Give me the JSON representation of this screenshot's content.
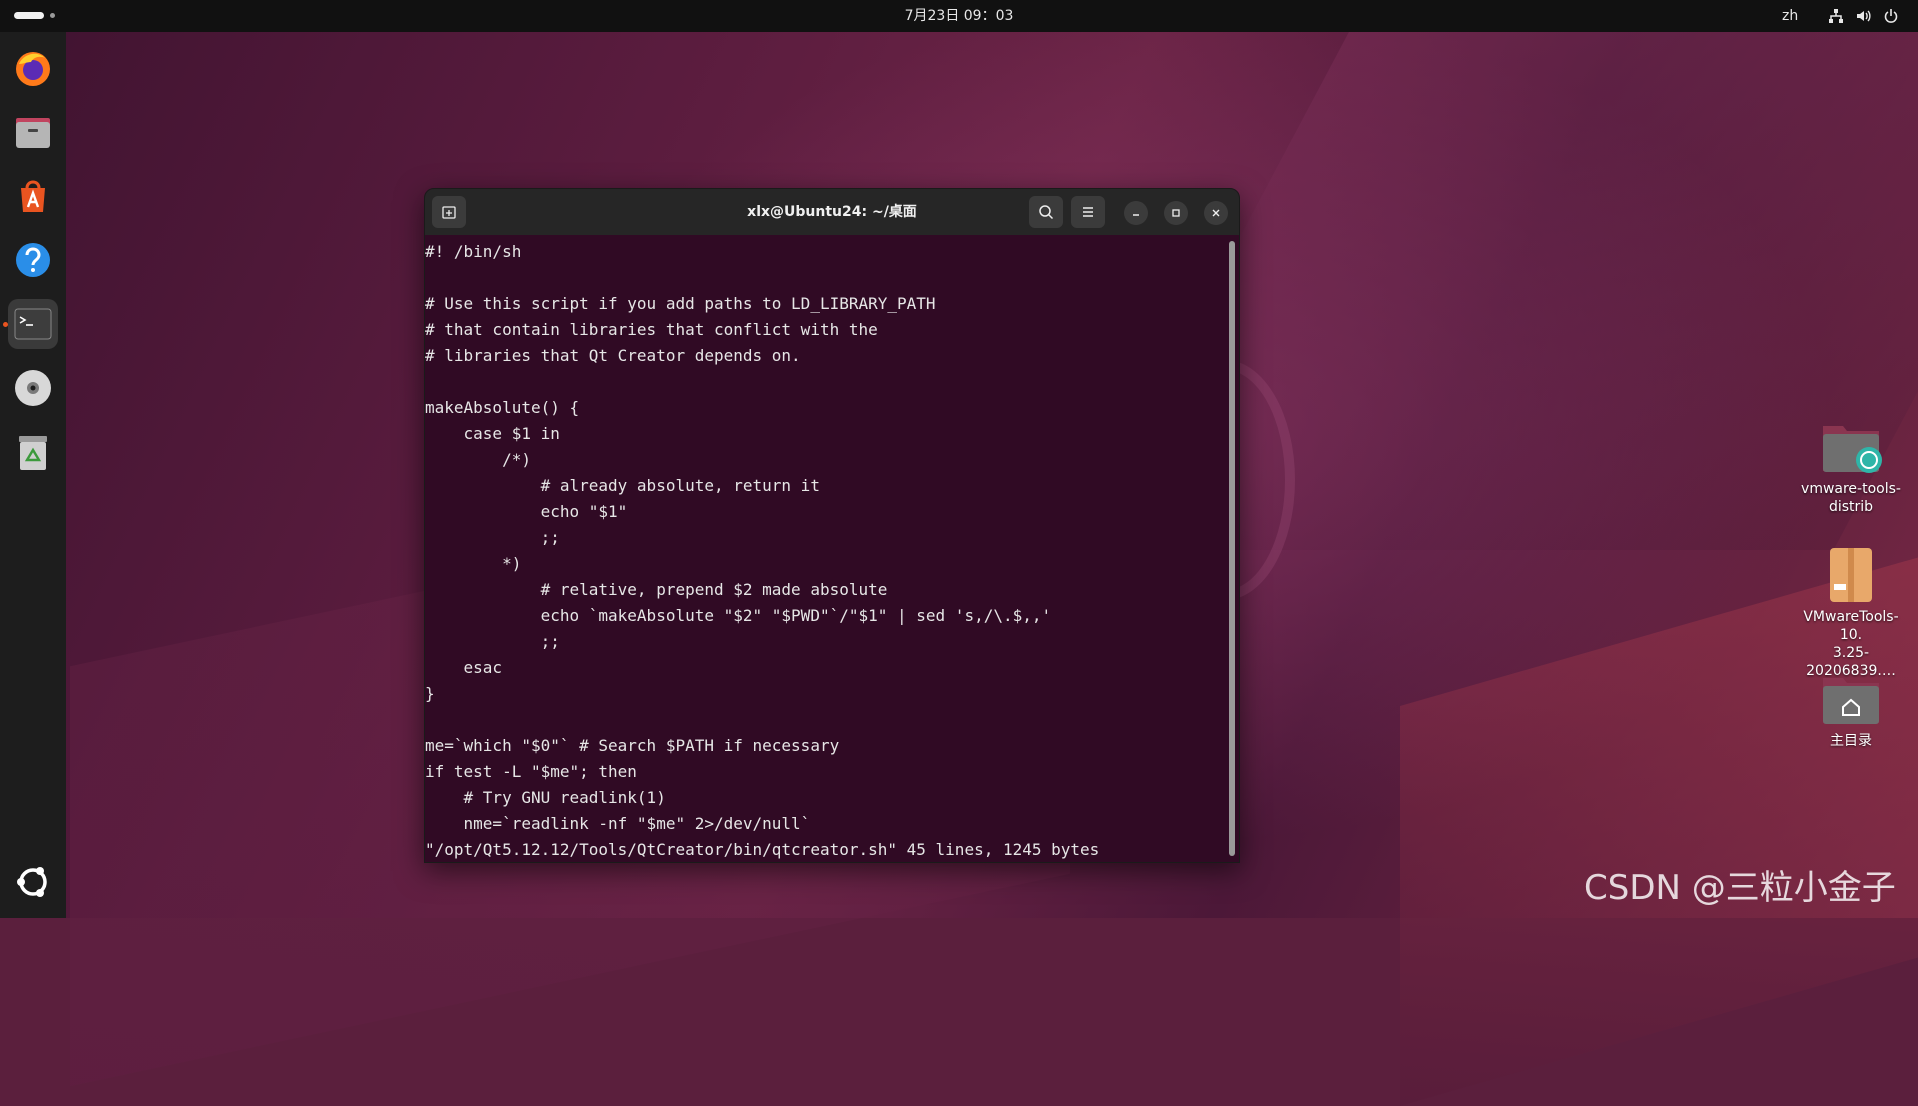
{
  "topbar": {
    "clock": "7月23日  09：03",
    "language": "zh",
    "icons": [
      "network-icon",
      "volume-icon",
      "power-icon"
    ]
  },
  "dock": {
    "items": [
      {
        "name": "firefox",
        "icon": "firefox-icon"
      },
      {
        "name": "files",
        "icon": "files-icon"
      },
      {
        "name": "app-center",
        "icon": "app-center-icon"
      },
      {
        "name": "help",
        "icon": "help-icon"
      },
      {
        "name": "terminal",
        "icon": "terminal-icon",
        "active": true
      },
      {
        "name": "dvd",
        "icon": "disc-icon"
      },
      {
        "name": "trash",
        "icon": "trash-icon"
      }
    ],
    "show_apps_icon": "ubuntu-logo-icon"
  },
  "terminal": {
    "title": "xlx@Ubuntu24: ~/桌面",
    "lines": [
      "#! /bin/sh",
      "",
      "# Use this script if you add paths to LD_LIBRARY_PATH",
      "# that contain libraries that conflict with the",
      "# libraries that Qt Creator depends on.",
      "",
      "makeAbsolute() {",
      "    case $1 in",
      "        /*)",
      "            # already absolute, return it",
      "            echo \"$1\"",
      "            ;;",
      "        *)",
      "            # relative, prepend $2 made absolute",
      "            echo `makeAbsolute \"$2\" \"$PWD\"`/\"$1\" | sed 's,/\\.$,,'",
      "            ;;",
      "    esac",
      "}",
      "",
      "me=`which \"$0\"` # Search $PATH if necessary",
      "if test -L \"$me\"; then",
      "    # Try GNU readlink(1)",
      "    nme=`readlink -nf \"$me\" 2>/dev/null`",
      "\"/opt/Qt5.12.12/Tools/QtCreator/bin/qtcreator.sh\" 45 lines, 1245 bytes"
    ]
  },
  "desktop": {
    "icons": [
      {
        "label_line1": "vmware-tools-",
        "label_line2": "distrib",
        "icon": "folder-icon"
      },
      {
        "label_line1": "VMwareTools-10.",
        "label_line2": "3.25-20206839.…",
        "icon": "archive-icon"
      },
      {
        "label_line1": "主目录",
        "label_line2": "",
        "icon": "home-folder-icon"
      }
    ]
  },
  "watermark": "CSDN @三粒小金子",
  "colors": {
    "terminal_bg": "#300a24",
    "accent": "#e95420",
    "topbar_bg": "#111111"
  }
}
